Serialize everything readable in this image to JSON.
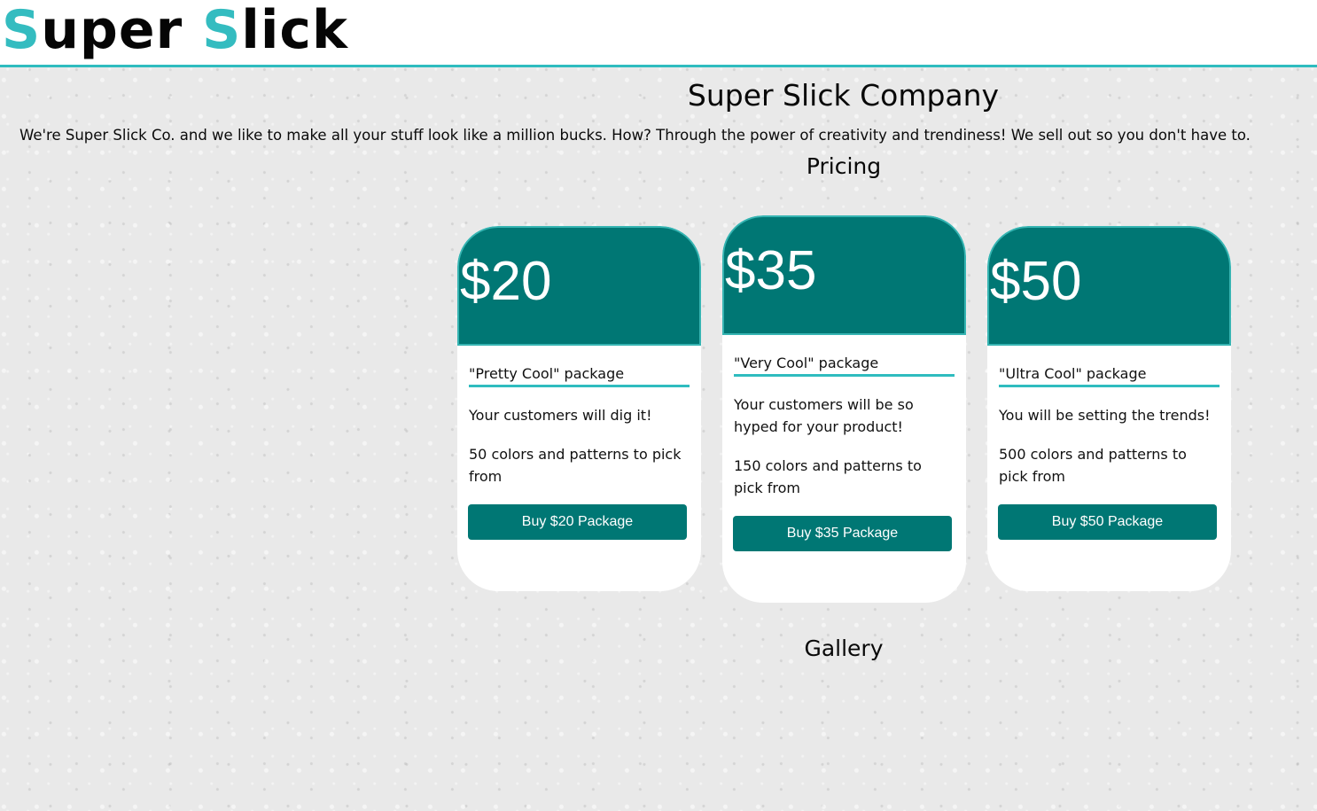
{
  "header": {
    "logo_first_initial": "S",
    "logo_first_rest": "uper",
    "logo_second_initial": "S",
    "logo_second_rest": "lick"
  },
  "main": {
    "title": "Super Slick Company",
    "intro": "We're Super Slick Co. and we like to make all your stuff look like a million bucks. How? Through the power of creativity and trendiness! We sell out so you don't have to.",
    "pricing_heading": "Pricing",
    "gallery_heading": "Gallery"
  },
  "pricing": [
    {
      "price": "$20",
      "package": "\"Pretty Cool\" package",
      "feature_1": "Your customers will dig it!",
      "feature_2": "50 colors and patterns to pick from",
      "button": "Buy $20 Package"
    },
    {
      "price": "$35",
      "package": "\"Very Cool\" package",
      "feature_1": "Your customers will be so hyped for your product!",
      "feature_2": "150 colors and patterns to pick from",
      "button": "Buy $35 Package"
    },
    {
      "price": "$50",
      "package": "\"Ultra Cool\" package",
      "feature_1": "You will be setting the trends!",
      "feature_2": "500 colors and patterns to pick from",
      "button": "Buy $50 Package"
    }
  ],
  "colors": {
    "accent": "#2fbcbf",
    "card_header": "#007774",
    "button": "#007774"
  }
}
